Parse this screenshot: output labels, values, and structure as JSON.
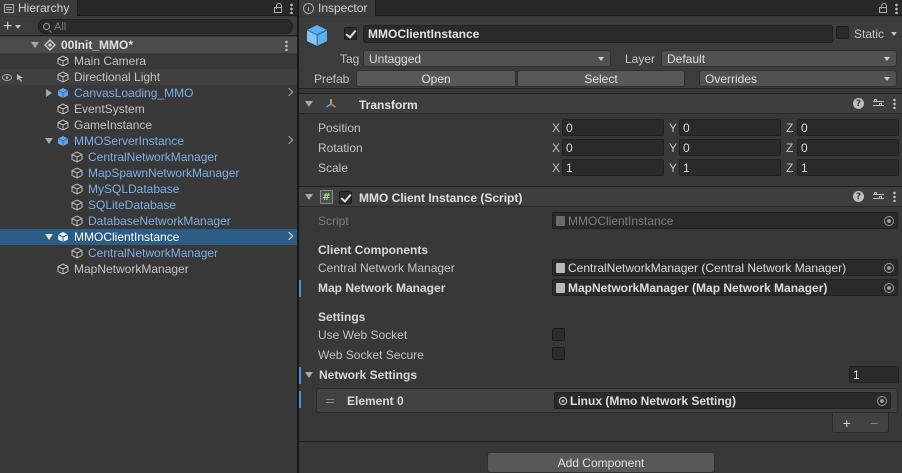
{
  "hierarchy": {
    "tab_label": "Hierarchy",
    "add_label": "+",
    "search_placeholder": "All",
    "scene": "00Init_MMO*",
    "items": [
      {
        "label": "Main Camera",
        "prefab": false
      },
      {
        "label": "Directional Light",
        "prefab": false
      },
      {
        "label": "CanvasLoading_MMO",
        "prefab": true
      },
      {
        "label": "EventSystem",
        "prefab": false
      },
      {
        "label": "GameInstance",
        "prefab": false
      },
      {
        "label": "MMOServerInstance",
        "prefab": true
      },
      {
        "label": "CentralNetworkManager",
        "prefab": true
      },
      {
        "label": "MapSpawnNetworkManager",
        "prefab": true
      },
      {
        "label": "MySQLDatabase",
        "prefab": true
      },
      {
        "label": "SQLiteDatabase",
        "prefab": true
      },
      {
        "label": "DatabaseNetworkManager",
        "prefab": true
      },
      {
        "label": "MMOClientInstance",
        "prefab": true
      },
      {
        "label": "CentralNetworkManager",
        "prefab": true
      },
      {
        "label": "MapNetworkManager",
        "prefab": false
      }
    ]
  },
  "inspector": {
    "tab_label": "Inspector",
    "object_name": "MMOClientInstance",
    "static_label": "Static",
    "tag_label": "Tag",
    "tag_value": "Untagged",
    "layer_label": "Layer",
    "layer_value": "Default",
    "prefab_label": "Prefab",
    "open_label": "Open",
    "select_label": "Select",
    "overrides_label": "Overrides",
    "transform": {
      "title": "Transform",
      "position_label": "Position",
      "rotation_label": "Rotation",
      "scale_label": "Scale",
      "axis_x": "X",
      "axis_y": "Y",
      "axis_z": "Z",
      "position": {
        "x": "0",
        "y": "0",
        "z": "0"
      },
      "rotation": {
        "x": "0",
        "y": "0",
        "z": "0"
      },
      "scale": {
        "x": "1",
        "y": "1",
        "z": "1"
      }
    },
    "script_component": {
      "title": "MMO Client Instance (Script)",
      "script_label": "Script",
      "script_value": "MMOClientInstance",
      "client_components_header": "Client Components",
      "central_label": "Central Network Manager",
      "central_value": "CentralNetworkManager (Central Network Manager)",
      "map_label": "Map Network Manager",
      "map_value": "MapNetworkManager (Map Network Manager)",
      "settings_header": "Settings",
      "use_web_socket_label": "Use Web Socket",
      "use_web_socket": false,
      "web_socket_secure_label": "Web Socket Secure",
      "web_socket_secure": false,
      "network_settings_label": "Network Settings",
      "network_settings_count": "1",
      "element0_label": "Element 0",
      "element0_value": "Linux (Mmo Network Setting)",
      "add_label": "+",
      "remove_label": "−"
    },
    "add_component_label": "Add Component"
  },
  "colors": {
    "selection": "#2c5d87",
    "prefab_text": "#7bafe6",
    "panel_bg": "#383838"
  }
}
